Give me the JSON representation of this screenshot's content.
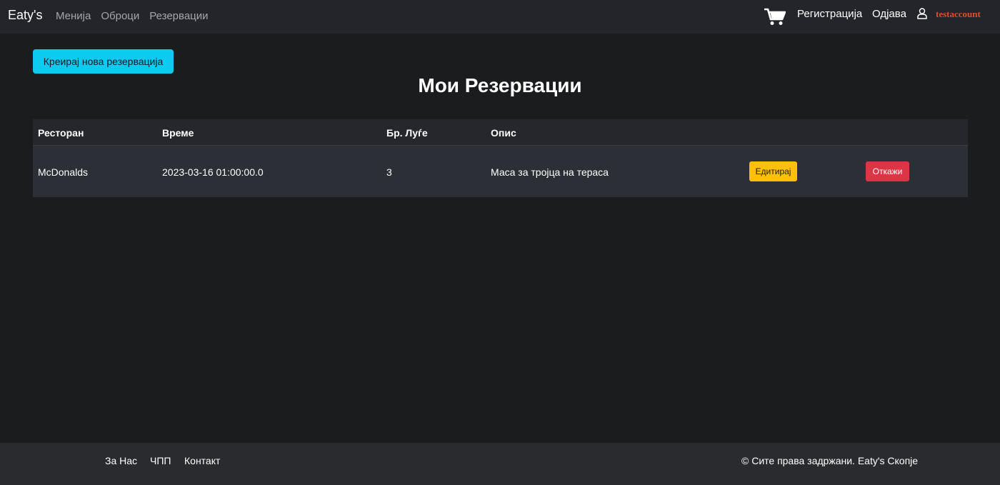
{
  "navbar": {
    "brand": "Eaty's",
    "links": [
      "Менија",
      "Оброци",
      "Резервации"
    ],
    "register": "Регистрација",
    "logout": "Одјава",
    "username": "testaccount",
    "icons": {
      "cart": "cart-icon",
      "user": "user-icon"
    }
  },
  "main": {
    "create_button": "Креирај нова резервација",
    "title": "Мои Резервации",
    "table": {
      "headers": [
        "Ресторан",
        "Време",
        "Бр. Луѓе",
        "Опис"
      ],
      "rows": [
        {
          "restaurant": "McDonalds",
          "time": "2023-03-16 01:00:00.0",
          "people": "3",
          "description": "Маса за тројца на тераса",
          "edit_label": "Едитирај",
          "cancel_label": "Откажи"
        }
      ]
    }
  },
  "footer": {
    "links": [
      "За Нас",
      "ЧПП",
      "Контакт"
    ],
    "copyright": "© Сите права задржани. Eaty's Скопје"
  },
  "colors": {
    "accent_info": "#0dcaf0",
    "warning": "#ffc107",
    "danger": "#dc3545",
    "username": "#e04e25"
  }
}
